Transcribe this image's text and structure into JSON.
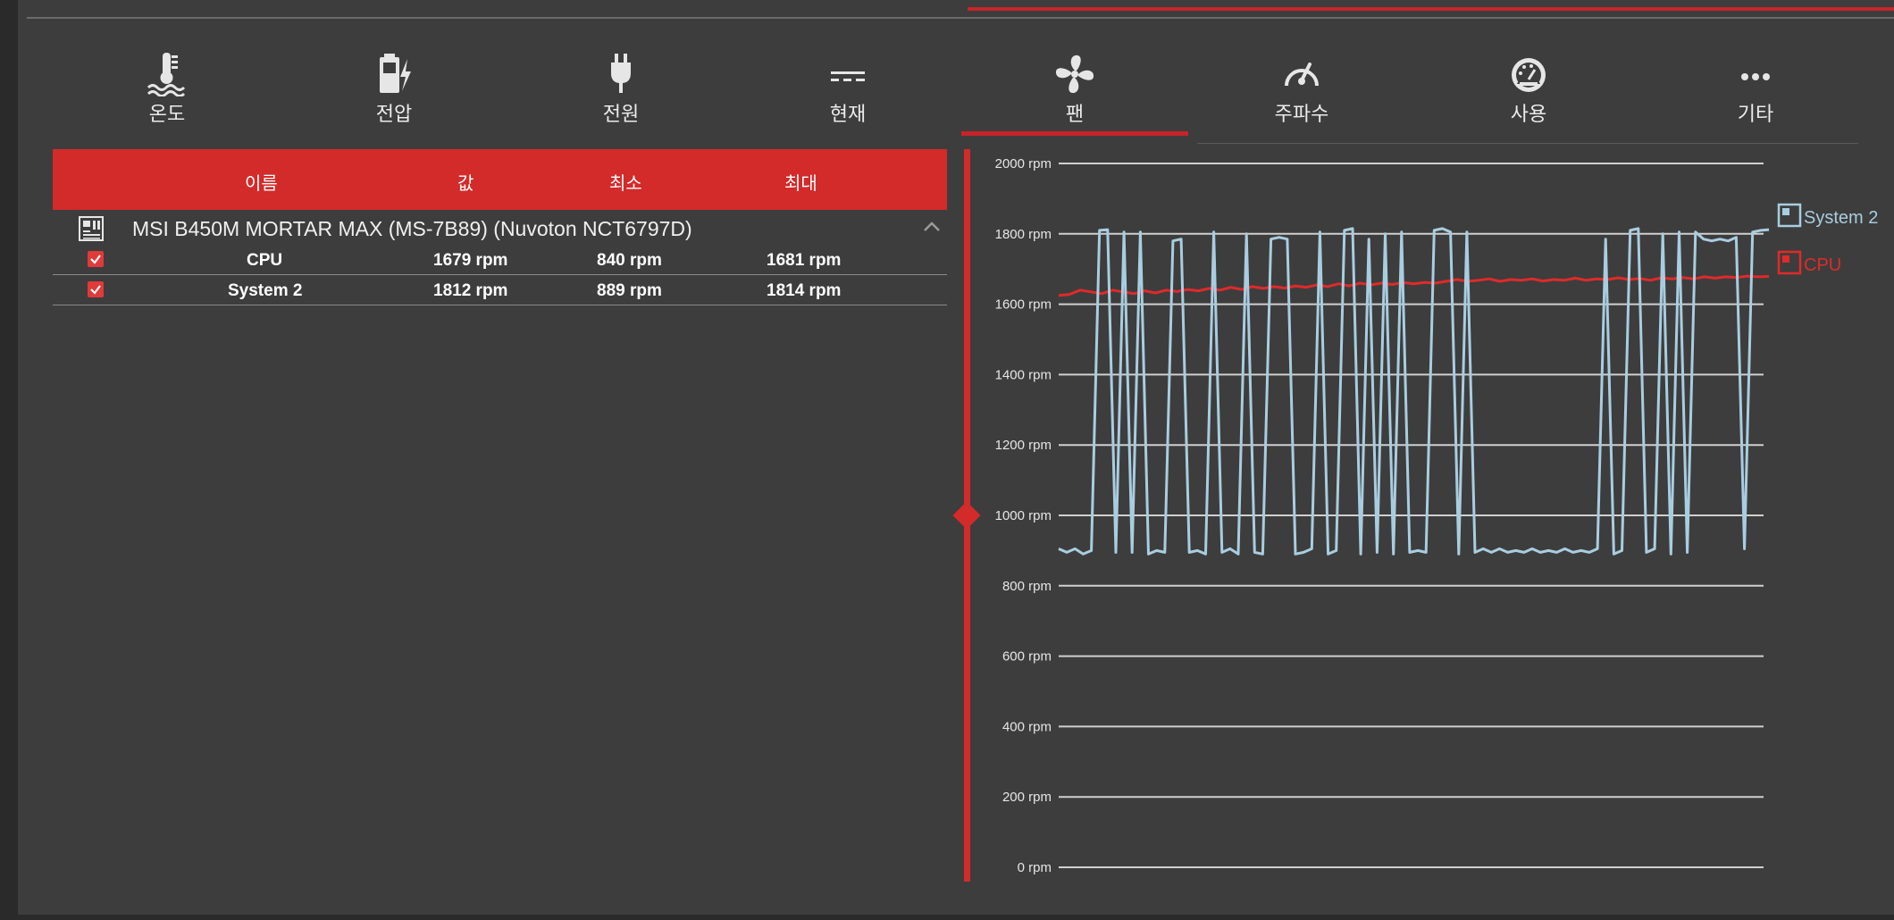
{
  "tabs": [
    {
      "label": "온도",
      "icon": "thermometer-icon",
      "active": false
    },
    {
      "label": "전압",
      "icon": "battery-bolt-icon",
      "active": false
    },
    {
      "label": "전원",
      "icon": "plug-icon",
      "active": false
    },
    {
      "label": "현재",
      "icon": "dc-current-icon",
      "active": false
    },
    {
      "label": "팬",
      "icon": "fan-icon",
      "active": true
    },
    {
      "label": "주파수",
      "icon": "gauge-icon",
      "active": false
    },
    {
      "label": "사용",
      "icon": "dashboard-icon",
      "active": false
    },
    {
      "label": "기타",
      "icon": "ellipsis-icon",
      "active": false
    }
  ],
  "table": {
    "headers": {
      "name": "이름",
      "value": "값",
      "min": "최소",
      "max": "최대"
    },
    "device": {
      "name": "MSI B450M MORTAR MAX (MS-7B89) (Nuvoton NCT6797D)",
      "icon": "motherboard-icon"
    },
    "rows": [
      {
        "name": "CPU",
        "value": "1679 rpm",
        "min": "840 rpm",
        "max": "1681 rpm",
        "checked": true
      },
      {
        "name": "System 2",
        "value": "1812 rpm",
        "min": "889 rpm",
        "max": "1814 rpm",
        "checked": true
      }
    ]
  },
  "colors": {
    "accent": "#d32a2a",
    "system2": "#a9cde0",
    "cpu": "#e02a2a",
    "background": "#3d3d3d"
  },
  "chart_data": {
    "type": "line",
    "ylim": [
      0,
      2000
    ],
    "yticks": [
      {
        "value": 2000,
        "label": "2000 rpm"
      },
      {
        "value": 1800,
        "label": "1800 rpm"
      },
      {
        "value": 1600,
        "label": "1600 rpm"
      },
      {
        "value": 1400,
        "label": "1400 rpm"
      },
      {
        "value": 1200,
        "label": "1200 rpm"
      },
      {
        "value": 1000,
        "label": "1000 rpm"
      },
      {
        "value": 800,
        "label": "800 rpm"
      },
      {
        "value": 600,
        "label": "600 rpm"
      },
      {
        "value": 400,
        "label": "400 rpm"
      },
      {
        "value": 200,
        "label": "200 rpm"
      },
      {
        "value": 0,
        "label": "0 rpm"
      }
    ],
    "grid": true,
    "legend_position": "right",
    "series": [
      {
        "name": "System 2",
        "values": [
          905,
          895,
          905,
          890,
          900,
          1810,
          1812,
          895,
          1805,
          895,
          1805,
          890,
          900,
          895,
          1780,
          1785,
          895,
          900,
          890,
          1805,
          895,
          905,
          890,
          1800,
          895,
          890,
          1785,
          1790,
          1785,
          890,
          895,
          905,
          1805,
          890,
          900,
          1810,
          1815,
          890,
          1785,
          895,
          1800,
          890,
          1805,
          895,
          900,
          895,
          1810,
          1815,
          1805,
          890,
          1805,
          895,
          905,
          895,
          905,
          895,
          900,
          895,
          905,
          895,
          900,
          895,
          905,
          895,
          900,
          895,
          905,
          1785,
          890,
          900,
          1810,
          1815,
          895,
          905,
          1800,
          890,
          1805,
          895,
          1805,
          1785,
          1780,
          1785,
          1780,
          1790,
          905,
          1805,
          1810,
          1812
        ],
        "color": "#a9cde0"
      },
      {
        "name": "CPU",
        "values": [
          1625,
          1628,
          1640,
          1635,
          1630,
          1640,
          1635,
          1630,
          1638,
          1632,
          1640,
          1636,
          1642,
          1638,
          1645,
          1640,
          1648,
          1642,
          1650,
          1645,
          1650,
          1646,
          1652,
          1648,
          1655,
          1650,
          1658,
          1652,
          1660,
          1655,
          1660,
          1656,
          1662,
          1658,
          1662,
          1660,
          1665,
          1670,
          1665,
          1668,
          1672,
          1665,
          1670,
          1668,
          1672,
          1666,
          1670,
          1668,
          1674,
          1668,
          1672,
          1670,
          1675,
          1670,
          1673,
          1668,
          1675,
          1672,
          1676,
          1672,
          1678,
          1674,
          1678,
          1676,
          1680,
          1678,
          1679
        ],
        "color": "#e02a2a"
      }
    ]
  }
}
